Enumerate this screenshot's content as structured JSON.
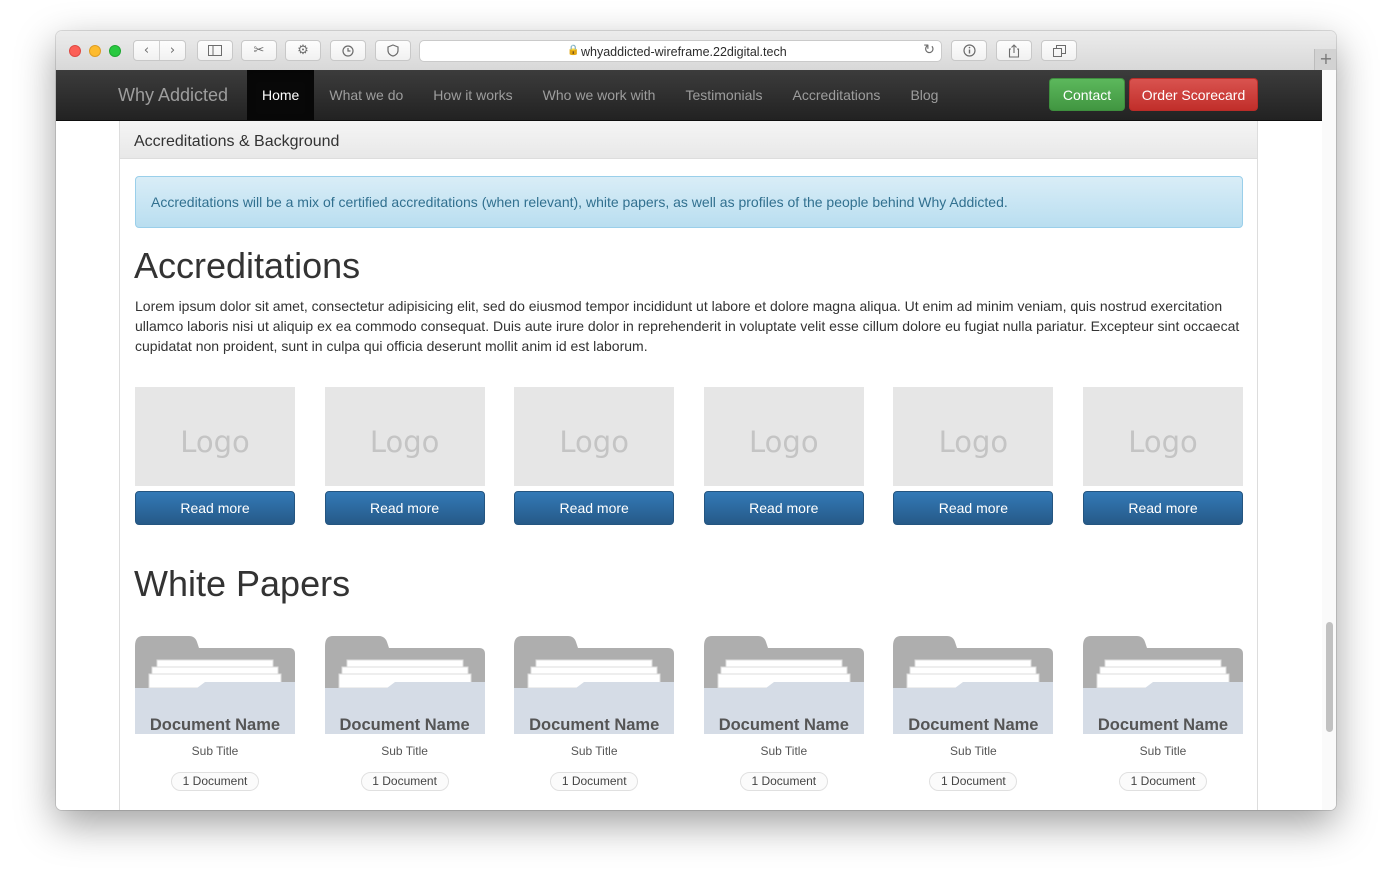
{
  "browser": {
    "url": "whyaddicted-wireframe.22digital.tech",
    "new_tab": "+"
  },
  "navbar": {
    "brand": "Why Addicted",
    "links": [
      "Home",
      "What we do",
      "How it works",
      "Who we work with",
      "Testimonials",
      "Accreditations",
      "Blog"
    ],
    "active": "Home",
    "contact_label": "Contact",
    "order_label": "Order Scorecard"
  },
  "panel": {
    "heading": "Accreditations & Background",
    "alert": "Accreditations will be a mix of certified accreditations (when relevant), white papers, as well as profiles of the people behind Why Addicted."
  },
  "accreditations": {
    "title": "Accreditations",
    "body": "Lorem ipsum dolor sit amet, consectetur adipisicing elit, sed do eiusmod tempor incididunt ut labore et dolore magna aliqua. Ut enim ad minim veniam, quis nostrud exercitation ullamco laboris nisi ut aliquip ex ea commodo consequat. Duis aute irure dolor in reprehenderit in voluptate velit esse cillum dolore eu fugiat nulla pariatur. Excepteur sint occaecat cupidatat non proident, sunt in culpa qui officia deserunt mollit anim id est laborum.",
    "cards": [
      {
        "logo": "Logo",
        "button": "Read more"
      },
      {
        "logo": "Logo",
        "button": "Read more"
      },
      {
        "logo": "Logo",
        "button": "Read more"
      },
      {
        "logo": "Logo",
        "button": "Read more"
      },
      {
        "logo": "Logo",
        "button": "Read more"
      },
      {
        "logo": "Logo",
        "button": "Read more"
      }
    ]
  },
  "white_papers": {
    "title": "White Papers",
    "documents": [
      {
        "name": "Document Name",
        "subtitle": "Sub Title",
        "count": "1 Document"
      },
      {
        "name": "Document Name",
        "subtitle": "Sub Title",
        "count": "1 Document"
      },
      {
        "name": "Document Name",
        "subtitle": "Sub Title",
        "count": "1 Document"
      },
      {
        "name": "Document Name",
        "subtitle": "Sub Title",
        "count": "1 Document"
      },
      {
        "name": "Document Name",
        "subtitle": "Sub Title",
        "count": "1 Document"
      },
      {
        "name": "Document Name",
        "subtitle": "Sub Title",
        "count": "1 Document"
      }
    ]
  },
  "colors": {
    "navbar": "#222222",
    "primary_button": "#337ab7",
    "success_button": "#5cb85c",
    "danger_button": "#d9534f",
    "alert_info": "#d9edf7",
    "folder": "#d5dce6",
    "folder_tab": "#aeaeae"
  },
  "icons": [
    "close-light",
    "minimize-light",
    "zoom-light",
    "back-icon",
    "forward-icon",
    "sidebar-icon",
    "clip-icon",
    "gear-icon",
    "history-icon",
    "shield-icon",
    "lock-icon",
    "reload-icon",
    "info-icon",
    "share-icon",
    "tabs-icon",
    "folder-icon"
  ]
}
